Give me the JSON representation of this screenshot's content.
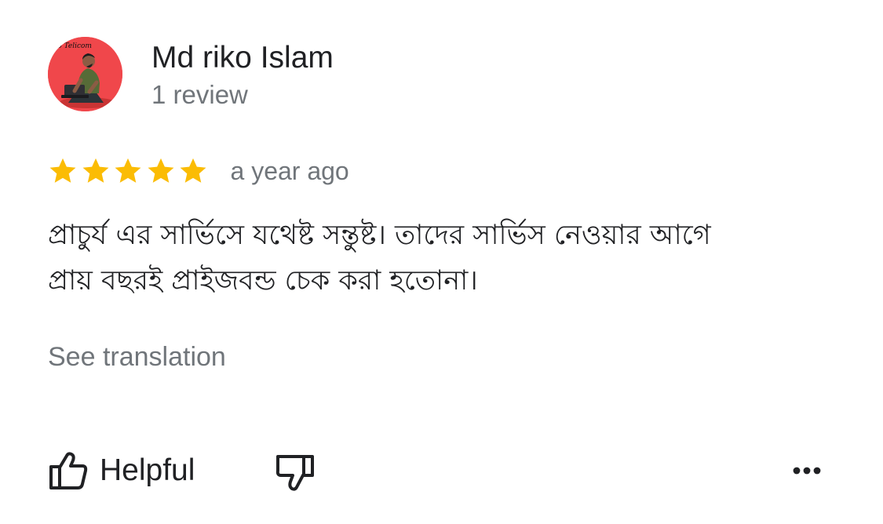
{
  "review": {
    "author_name": "Md riko Islam",
    "author_reviews": "1 review",
    "avatar_overlay_text": "ro Telicom",
    "rating_value": 5,
    "rating_max": 5,
    "time_ago": "a year ago",
    "text_line_1": "প্রাচুর্য এর সার্ভিসে যথেষ্ট সন্তুষ্ট। তাদের সার্ভিস নেওয়ার আগে",
    "text_line_2": "প্রায় বছরই প্রাইজবন্ড চেক করা হতোনা।",
    "see_translation_label": "See translation"
  },
  "actions": {
    "helpful_label": "Helpful",
    "helpful_icon": "thumbs-up-icon",
    "not_helpful_icon": "thumbs-down-icon",
    "more_icon": "more-horizontal-icon"
  },
  "colors": {
    "star": "#fbbc04",
    "primary_text": "#202124",
    "secondary_text": "#70757a",
    "avatar_background": "#f0474b"
  }
}
